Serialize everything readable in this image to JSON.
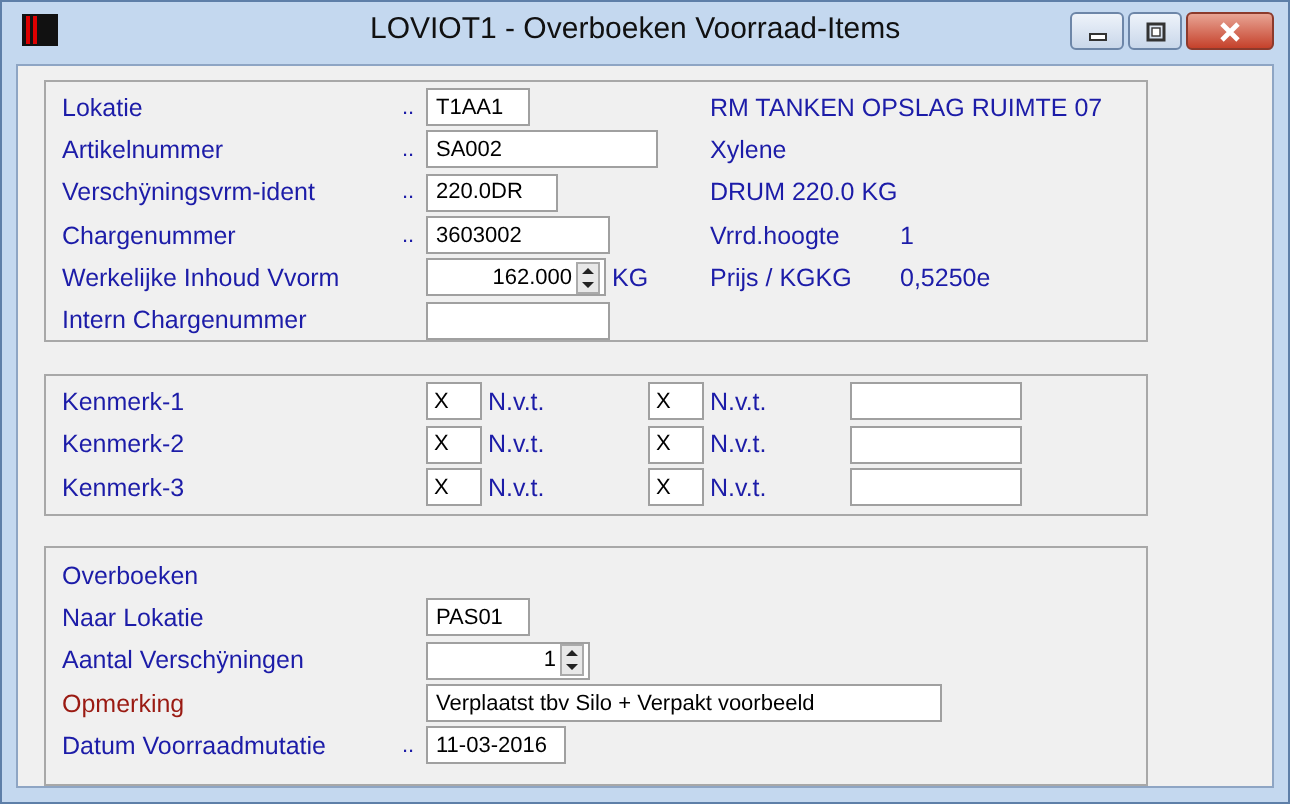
{
  "window": {
    "title": "LOVIOT1 - Overboeken Voorraad-Items"
  },
  "item_section": {
    "fields": [
      {
        "label": "Lokatie",
        "marker": "..",
        "kind": "text",
        "value": "T1AA1",
        "highlighted": false
      },
      {
        "label": "Artikelnummer",
        "marker": "..",
        "kind": "text",
        "value": "SA002",
        "highlighted": false
      },
      {
        "label": "Verschÿningsvrm-ident",
        "marker": "..",
        "kind": "text",
        "value": "220.0DR",
        "highlighted": false
      },
      {
        "label": "Chargenummer",
        "marker": "..",
        "kind": "text",
        "value": "3603002",
        "highlighted": false
      },
      {
        "label": "Werkelijke Inhoud Vvorm",
        "kind": "spinner",
        "value": "162.000",
        "unit": "KG",
        "highlighted": false
      },
      {
        "label": "Intern Chargenummer",
        "kind": "text",
        "highlighted": false
      }
    ],
    "info": [
      {
        "label": "RM TANKEN OPSLAG RUIMTE 07"
      },
      {
        "label": "Xylene"
      },
      {
        "label": "DRUM 220.0 KG"
      },
      {
        "label": "Vrrd.hoogte",
        "value": "1"
      },
      {
        "label": "Prijs / KGKG",
        "value": "0,5250e"
      }
    ]
  },
  "characteristics": [
    {
      "label": "Kenmerk-1",
      "code_1": "X",
      "text_1": "N.v.t.",
      "code_2": "X",
      "text_2": "N.v.t."
    },
    {
      "label": "Kenmerk-2",
      "code_1": "X",
      "text_1": "N.v.t.",
      "code_2": "X",
      "text_2": "N.v.t."
    },
    {
      "label": "Kenmerk-3",
      "code_1": "X",
      "text_1": "N.v.t.",
      "code_2": "X",
      "text_2": "N.v.t."
    }
  ],
  "transfer_section": {
    "heading": "Overboeken",
    "fields": [
      {
        "label": "Naar Lokatie",
        "kind": "text",
        "value": "PAS01",
        "highlighted": false
      },
      {
        "label": "Aantal Verschÿningen",
        "kind": "spinner",
        "value": "1",
        "highlighted": false
      },
      {
        "label": "Opmerking",
        "kind": "text",
        "value": "Verplaatst tbv Silo + Verpakt voorbeeld",
        "highlighted": true
      },
      {
        "label": "Datum Voorraadmutatie",
        "marker": "..",
        "kind": "text",
        "value": "11-03-2016",
        "highlighted": false
      }
    ]
  }
}
